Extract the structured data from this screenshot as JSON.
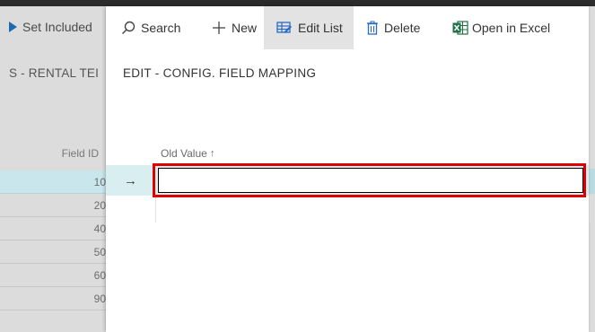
{
  "background_page": {
    "action_label": "Set Included",
    "title": "S - RENTAL TEI",
    "column_header": "Field ID",
    "field_ids": [
      "10",
      "20",
      "40",
      "50",
      "60",
      "90"
    ]
  },
  "dialog": {
    "toolbar": {
      "search_label": "Search",
      "new_label": "New",
      "edit_list_label": "Edit List",
      "delete_label": "Delete",
      "open_in_excel_label": "Open in Excel"
    },
    "title": "EDIT - CONFIG. FIELD MAPPING",
    "column_header": "Old Value",
    "sort_indicator": "↑",
    "row_indicator": "→",
    "old_value": "",
    "highlight_color": "#e00000"
  }
}
